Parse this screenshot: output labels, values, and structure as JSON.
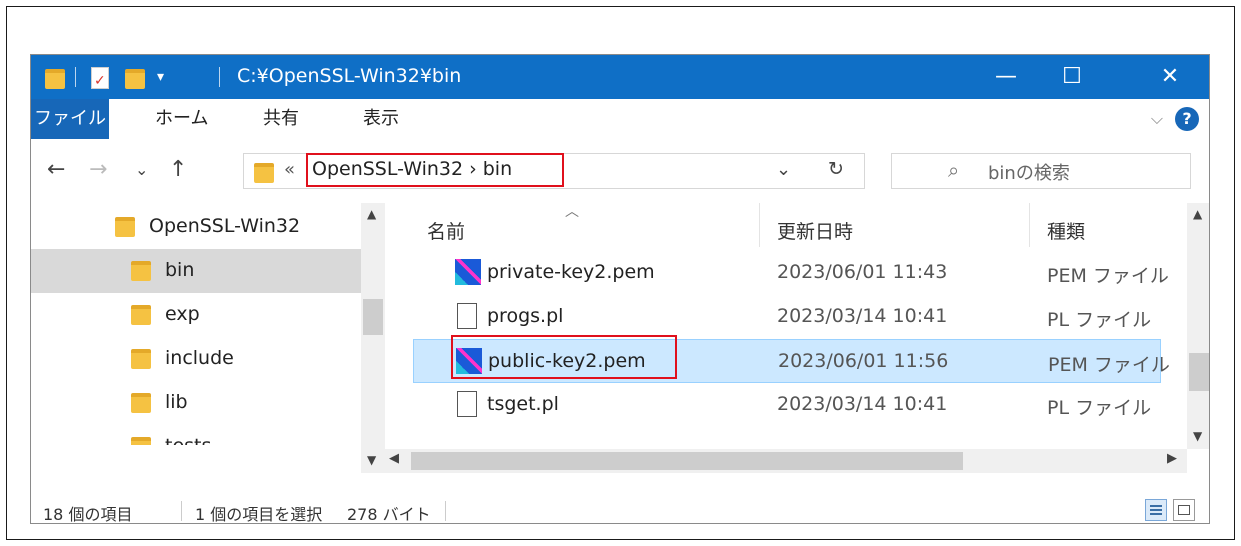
{
  "window": {
    "path_title": "C:¥OpenSSL-Win32¥bin",
    "minimize": "—",
    "maximize": "☐",
    "close": "✕"
  },
  "ribbon": {
    "tabs": [
      "ファイル",
      "ホーム",
      "共有",
      "表示"
    ],
    "collapse": "⌵",
    "help": "?"
  },
  "nav": {
    "back": "←",
    "forward": "→",
    "recent": "⌄",
    "up": "↑",
    "overflow": "«",
    "breadcrumb": "OpenSSL-Win32  ›  bin",
    "dropdown": "⌄",
    "refresh": "↻",
    "search_placeholder": "binの検索",
    "search_icon": "⌕"
  },
  "tree": {
    "items": [
      "OpenSSL-Win32",
      "bin",
      "exp",
      "include",
      "lib",
      "tests"
    ],
    "selected_index": 1
  },
  "files": {
    "columns": [
      "名前",
      "更新日時",
      "種類"
    ],
    "rows": [
      {
        "name": "private-key2.pem",
        "modified": "2023/06/01 11:43",
        "type": "PEM ファイル",
        "icon": "pem-file-icon"
      },
      {
        "name": "progs.pl",
        "modified": "2023/03/14 10:41",
        "type": "PL ファイル",
        "icon": "document-icon"
      },
      {
        "name": "public-key2.pem",
        "modified": "2023/06/01 11:56",
        "type": "PEM ファイル",
        "icon": "pem-file-icon"
      },
      {
        "name": "tsget.pl",
        "modified": "2023/03/14 10:41",
        "type": "PL ファイル",
        "icon": "document-icon"
      }
    ],
    "selected_index": 2
  },
  "status": {
    "item_count": "18 個の項目",
    "selection": "1 個の項目を選択",
    "size": "278 バイト"
  },
  "colors": {
    "title_bar": "#0f6fc6",
    "file_tab": "#1767b8",
    "selection": "#cce8ff",
    "highlight_box": "#e0101c",
    "folder": "#f5c242"
  }
}
